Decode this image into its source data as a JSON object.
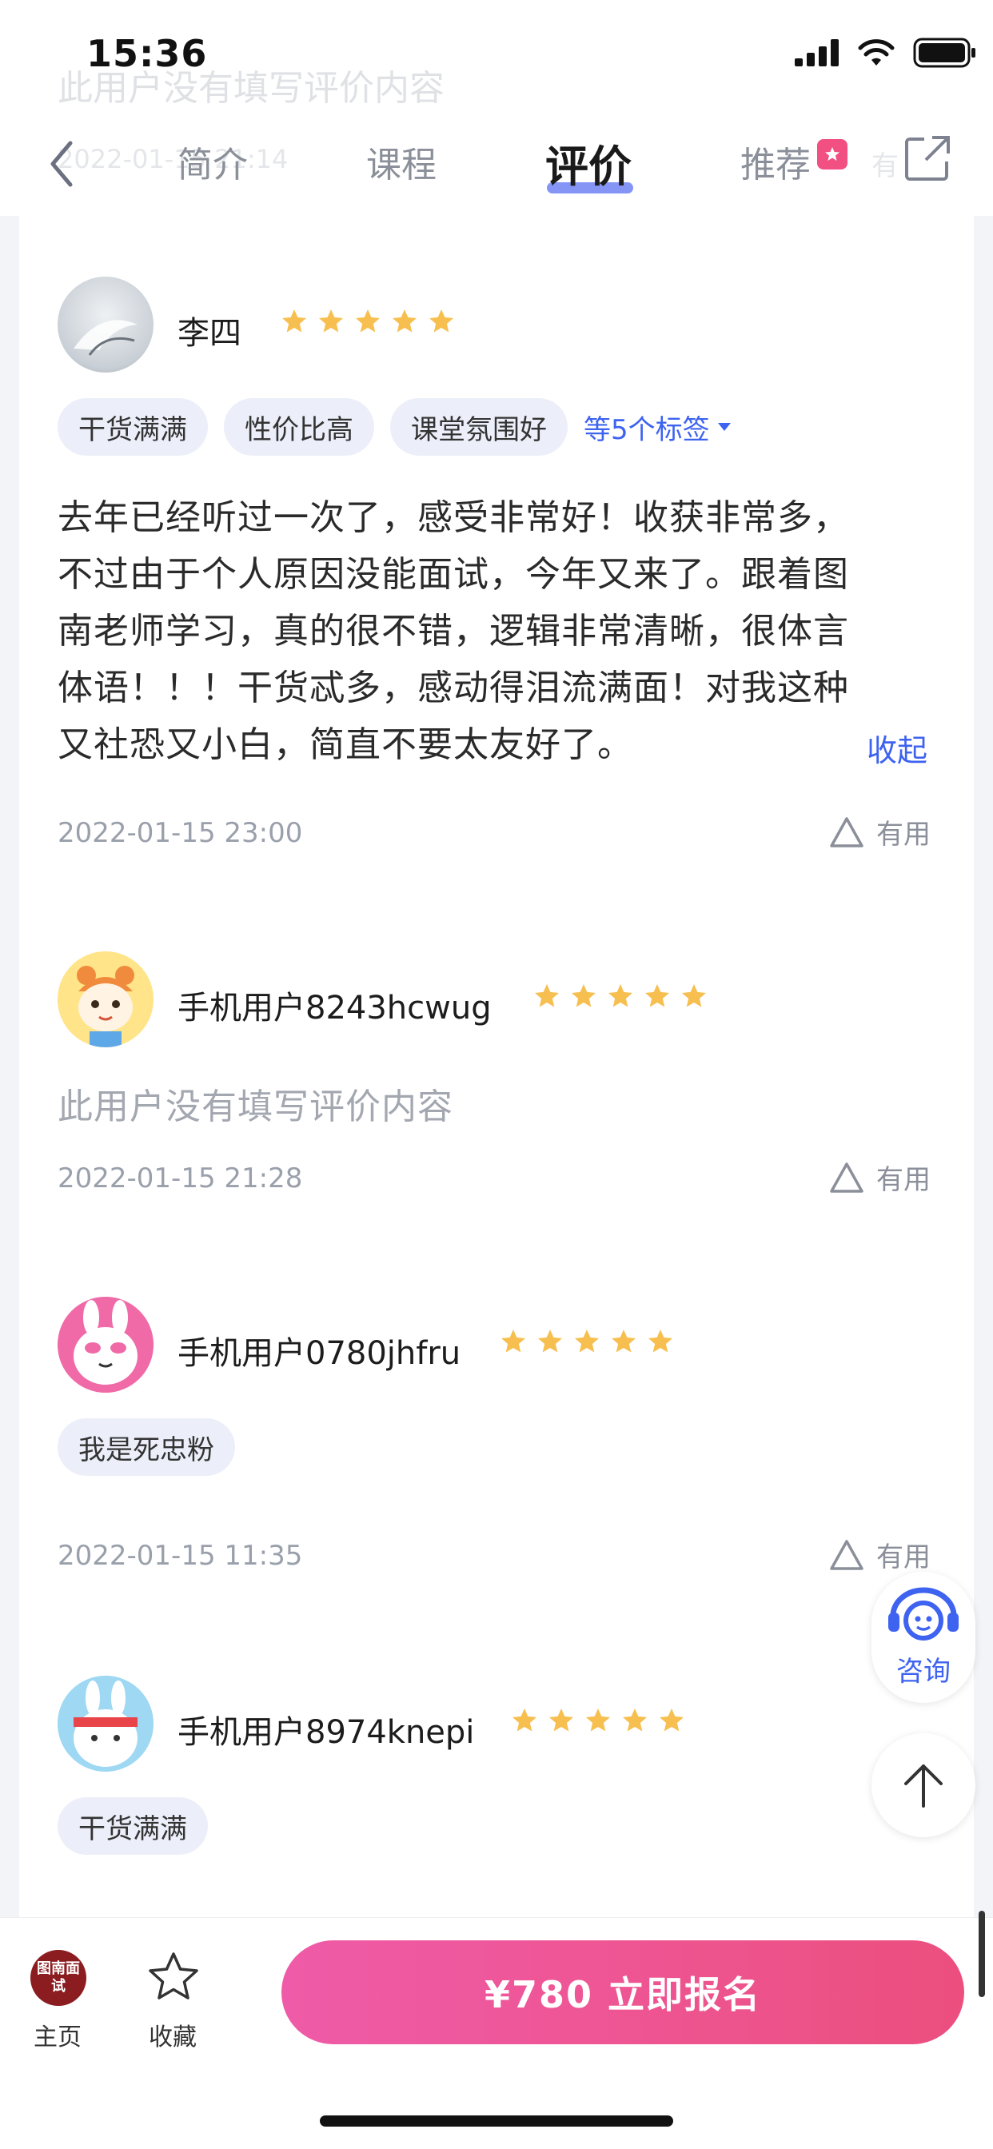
{
  "status": {
    "time": "15:36"
  },
  "ghost": {
    "text": "此用户没有填写评价内容",
    "date": "2022-01-15 21:14",
    "useful": "有"
  },
  "header": {
    "tabs": [
      {
        "label": "简介"
      },
      {
        "label": "课程"
      },
      {
        "label": "评价",
        "active": true
      },
      {
        "label": "推荐"
      }
    ]
  },
  "reviews": [
    {
      "username": "李四",
      "rating": 5,
      "tags": [
        "干货满满",
        "性价比高",
        "课堂氛围好"
      ],
      "more_tags": "等5个标签",
      "lines": [
        "去年已经听过一次了，感受非常好！收获非常多，",
        "不过由于个人原因没能面试，今年又来了。跟着图",
        "南老师学习，真的很不错，逻辑非常清晰，很体言",
        "体语！！！干货忒多，感动得泪流满面！对我这种",
        "又社恐又小白，简直不要太友好了。"
      ],
      "collapse": "收起",
      "date": "2022-01-15 23:00",
      "useful": "有用"
    },
    {
      "username": "手机用户8243hcwug",
      "rating": 5,
      "empty_text": "此用户没有填写评价内容",
      "date": "2022-01-15 21:28",
      "useful": "有用"
    },
    {
      "username": "手机用户0780jhfru",
      "rating": 5,
      "tags": [
        "我是死忠粉"
      ],
      "date": "2022-01-15 11:35",
      "useful": "有用"
    },
    {
      "username": "手机用户8974knepi",
      "rating": 5,
      "tags": [
        "干货满满"
      ]
    }
  ],
  "floating": {
    "consult_label": "咨询"
  },
  "bottom": {
    "logo_text": "图南面试",
    "home_label": "主页",
    "favorite_label": "收藏",
    "cta": "¥780  立即报名"
  },
  "colors": {
    "accent": "#3e63f0",
    "star": "#f7bf4f",
    "cta_start": "#ef5ba8",
    "cta_end": "#ec4f7e",
    "tag_bg": "#eceff9"
  }
}
